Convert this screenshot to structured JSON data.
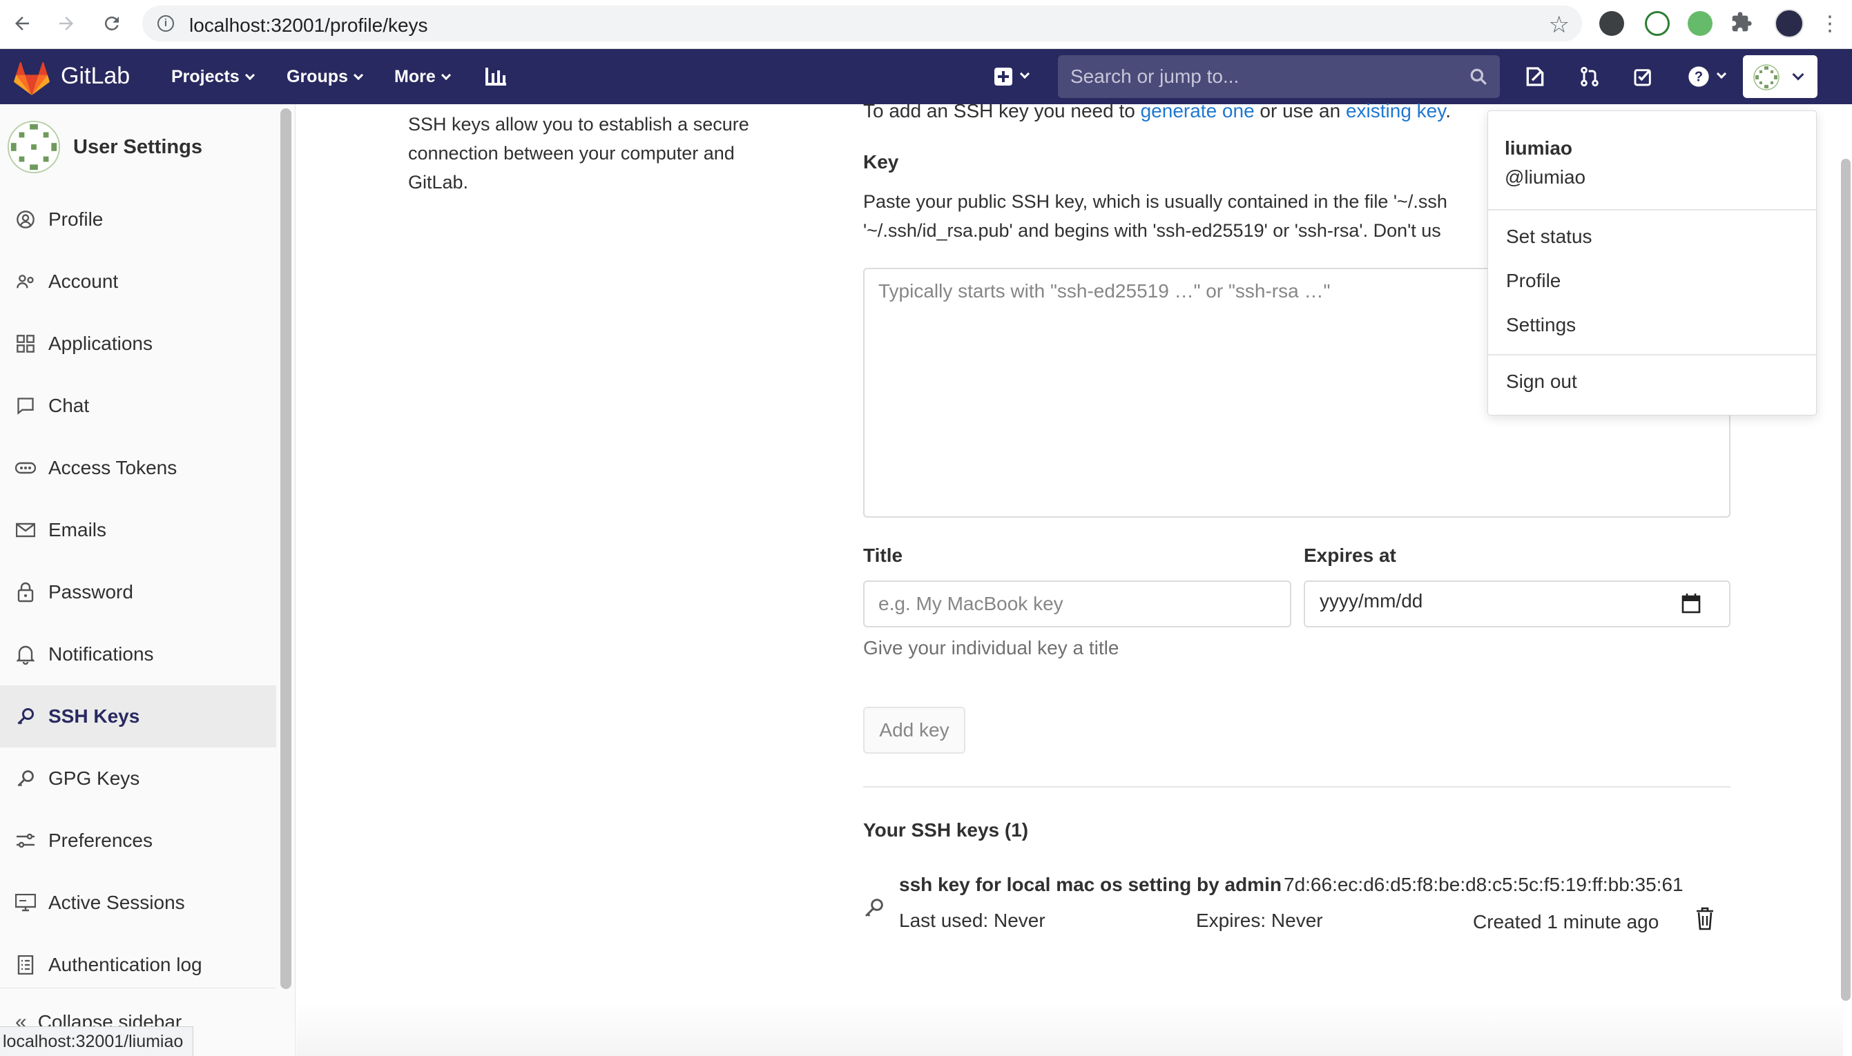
{
  "browser": {
    "url": "localhost:32001/profile/keys",
    "status_url": "localhost:32001/liumiao"
  },
  "header": {
    "brand": "GitLab",
    "nav": [
      {
        "label": "Projects"
      },
      {
        "label": "Groups"
      },
      {
        "label": "More"
      }
    ],
    "search_placeholder": "Search or jump to..."
  },
  "sidebar": {
    "title": "User Settings",
    "items": [
      {
        "label": "Profile",
        "icon": "profile-icon"
      },
      {
        "label": "Account",
        "icon": "account-icon"
      },
      {
        "label": "Applications",
        "icon": "applications-icon"
      },
      {
        "label": "Chat",
        "icon": "chat-icon"
      },
      {
        "label": "Access Tokens",
        "icon": "token-icon"
      },
      {
        "label": "Emails",
        "icon": "mail-icon"
      },
      {
        "label": "Password",
        "icon": "lock-icon"
      },
      {
        "label": "Notifications",
        "icon": "bell-icon"
      },
      {
        "label": "SSH Keys",
        "icon": "key-icon",
        "active": true
      },
      {
        "label": "GPG Keys",
        "icon": "key-icon"
      },
      {
        "label": "Preferences",
        "icon": "preferences-icon"
      },
      {
        "label": "Active Sessions",
        "icon": "monitor-icon"
      },
      {
        "label": "Authentication log",
        "icon": "log-icon"
      }
    ],
    "collapse_label": "Collapse sidebar"
  },
  "main": {
    "description": "SSH keys allow you to establish a secure connection between your computer and GitLab.",
    "intro_prefix": "To add an SSH key you need to ",
    "intro_link1": "generate one",
    "intro_middle": " or use an ",
    "intro_link2": "existing key",
    "intro_suffix": ".",
    "key_label": "Key",
    "key_help_line1": "Paste your public SSH key, which is usually contained in the file '~/.ssh",
    "key_help_line2": "'~/.ssh/id_rsa.pub' and begins with 'ssh-ed25519' or 'ssh-rsa'. Don't us",
    "key_placeholder": "Typically starts with \"ssh-ed25519 …\" or \"ssh-rsa …\"",
    "title_label": "Title",
    "title_placeholder": "e.g. My MacBook key",
    "title_help": "Give your individual key a title",
    "expires_label": "Expires at",
    "expires_value": "yyyy/mm/dd",
    "add_button": "Add key",
    "keys_heading": "Your SSH keys (1)",
    "keys": [
      {
        "name": "ssh key for local mac os setting by admin",
        "fingerprint": "7d:66:ec:d6:d5:f8:be:d8:c5:5c:f5:19:ff:bb:35:61",
        "last_used": "Last used: Never",
        "expires": "Expires: Never",
        "created": "Created 1 minute ago"
      }
    ]
  },
  "user_menu": {
    "name": "liumiao",
    "handle": "@liumiao",
    "items": [
      "Set status",
      "Profile",
      "Settings"
    ],
    "sign_out": "Sign out"
  },
  "colors": {
    "header_bg": "#292961",
    "link": "#1f78d1",
    "sidebar_active_bg": "#ebebeb"
  }
}
